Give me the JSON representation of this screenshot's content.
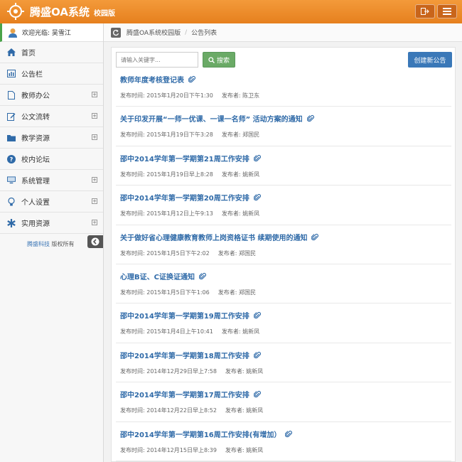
{
  "header": {
    "app_title": "腾盛OA系统",
    "app_sub": "校园版"
  },
  "sidebar": {
    "welcome": "欢迎光临: 吴雪江",
    "items": [
      {
        "label": "首页",
        "icon": "home-icon",
        "expandable": false
      },
      {
        "label": "公告栏",
        "icon": "bar-chart-icon",
        "expandable": false
      },
      {
        "label": "教师办公",
        "icon": "file-icon",
        "expandable": true
      },
      {
        "label": "公文流转",
        "icon": "edit-icon",
        "expandable": true
      },
      {
        "label": "教学资源",
        "icon": "folder-icon",
        "expandable": true
      },
      {
        "label": "校内论坛",
        "icon": "question-icon",
        "expandable": false
      },
      {
        "label": "系统管理",
        "icon": "monitor-icon",
        "expandable": true
      },
      {
        "label": "个人设置",
        "icon": "lightbulb-icon",
        "expandable": true
      },
      {
        "label": "实用资源",
        "icon": "asterisk-icon",
        "expandable": true
      }
    ],
    "copyright_link": "腾盛科技",
    "copyright_text": "版权所有"
  },
  "breadcrumb": {
    "home": "腾盛OA系统校园版",
    "current": "公告列表"
  },
  "toolbar": {
    "search_placeholder": "请输入关键字...",
    "search_label": "搜索",
    "new_label": "创建新公告"
  },
  "announcements": [
    {
      "title": "教师年度考核登记表",
      "time": "发布时间: 2015年1月20日下午1:30",
      "author": "发布者: 陈卫东"
    },
    {
      "title": "关于印发开展“一师一优课、一课一名师” 活动方案的通知",
      "time": "发布时间: 2015年1月19日下午3:28",
      "author": "发布者: 郑国民"
    },
    {
      "title": "邵中2014学年第一学期第21周工作安排",
      "time": "发布时间: 2015年1月19日早上8:28",
      "author": "发布者: 姚新凤"
    },
    {
      "title": "邵中2014学年第一学期第20周工作安排",
      "time": "发布时间: 2015年1月12日上午9:13",
      "author": "发布者: 姚新凤"
    },
    {
      "title": "关于做好省心理健康教育教师上岗资格证书 续期使用的通知",
      "time": "发布时间: 2015年1月5日下午2:02",
      "author": "发布者: 郑国民"
    },
    {
      "title": "心理B证、C证换证通知",
      "time": "发布时间: 2015年1月5日下午1:06",
      "author": "发布者: 郑国民"
    },
    {
      "title": "邵中2014学年第一学期第19周工作安排",
      "time": "发布时间: 2015年1月4日上午10:41",
      "author": "发布者: 姚新凤"
    },
    {
      "title": "邵中2014学年第一学期第18周工作安排",
      "time": "发布时间: 2014年12月29日早上7:58",
      "author": "发布者: 姚新凤"
    },
    {
      "title": "邵中2014学年第一学期第17周工作安排",
      "time": "发布时间: 2014年12月22日早上8:52",
      "author": "发布者: 姚新凤"
    },
    {
      "title": "邵中2014学年第一学期第16周工作安排(有增加）",
      "time": "发布时间: 2014年12月15日早上8:39",
      "author": "发布者: 姚新凤"
    }
  ],
  "colors": {
    "header_orange": "#e6801e",
    "link_blue": "#2f6aa8",
    "search_green": "#6aaa66",
    "new_blue": "#3a78b8"
  }
}
